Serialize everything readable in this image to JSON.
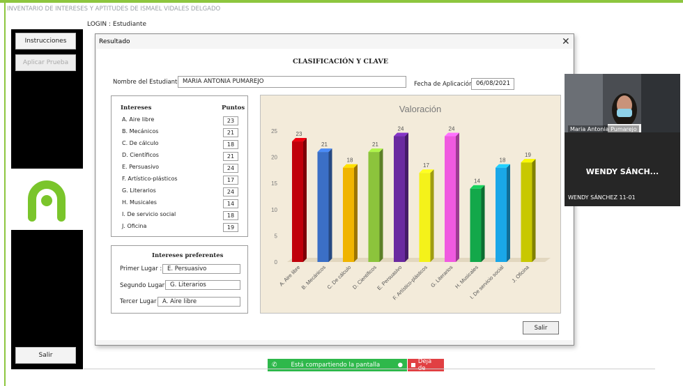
{
  "window": {
    "title": "INVENTARIO DE INTERESES Y APTITUDES DE ISMAEL VIDALES DELGADO"
  },
  "login": "LOGIN : Estudiante",
  "sidebar": {
    "instructions_label": "Instrucciones",
    "apply_label": "Aplicar Prueba",
    "exit_label": "Salir"
  },
  "dialog": {
    "title": "Resultado",
    "close_glyph": "✕",
    "heading": "CLASIFICACIÓN Y CLAVE",
    "student_label": "Nombre del Estudiante :",
    "student_value": "MARIA ANTONIA PUMAREJO",
    "date_label": "Fecha de Aplicación :",
    "date_value": "06/08/2021",
    "interests_header": "Intereses",
    "points_header": "Puntos",
    "interests": [
      {
        "name": "A. Aire libre",
        "points": "23"
      },
      {
        "name": "B. Mecánicos",
        "points": "21"
      },
      {
        "name": "C. De cálculo",
        "points": "18"
      },
      {
        "name": "D. Científicos",
        "points": "21"
      },
      {
        "name": "E. Persuasivo",
        "points": "24"
      },
      {
        "name": "F. Artístico-plásticos",
        "points": "17"
      },
      {
        "name": "G. Literarios",
        "points": "24"
      },
      {
        "name": "H. Musicales",
        "points": "14"
      },
      {
        "name": "I. De servicio social",
        "points": "18"
      },
      {
        "name": "J. Oficina",
        "points": "19"
      }
    ],
    "preferred": {
      "title": "Intereses preferentes",
      "first_label": "Primer Lugar :",
      "first_value": "E. Persuasivo",
      "second_label": "Segundo Lugar :",
      "second_value": "G. Literarios",
      "third_label": "Tercer Lugar :",
      "third_value": "A. Aire libre"
    },
    "exit_label": "Salir"
  },
  "chart_data": {
    "type": "bar",
    "title": "Valoración",
    "categories": [
      "A. Aire libre",
      "B. Mecánicos",
      "C. De cálculo",
      "D. Científicos",
      "E. Persuasivo",
      "F. Artístico-plásticos",
      "G. Literarios",
      "H. Musicales",
      "I. De servicio social",
      "J. Oficina"
    ],
    "values": [
      23,
      21,
      18,
      21,
      24,
      17,
      24,
      14,
      18,
      19
    ],
    "colors": [
      "#c0000b",
      "#3b6fc6",
      "#f0b400",
      "#8cc43c",
      "#6a2aa0",
      "#f4f21a",
      "#f05ae0",
      "#13a84a",
      "#1aa7e8",
      "#c8c800"
    ],
    "yticks": [
      0,
      5,
      10,
      15,
      20,
      25
    ],
    "ylim": [
      0,
      25
    ],
    "grid": false,
    "xlabel": "",
    "ylabel": ""
  },
  "video": {
    "participant_name": "Maria Antonia Pumarejo",
    "tile_name": "WENDY SÁNCH...",
    "tile_label": "WENDY SÁNCHEZ 11-01"
  },
  "share": {
    "message": "Está compartiendo la pantalla",
    "stop_label": "Deja de"
  }
}
